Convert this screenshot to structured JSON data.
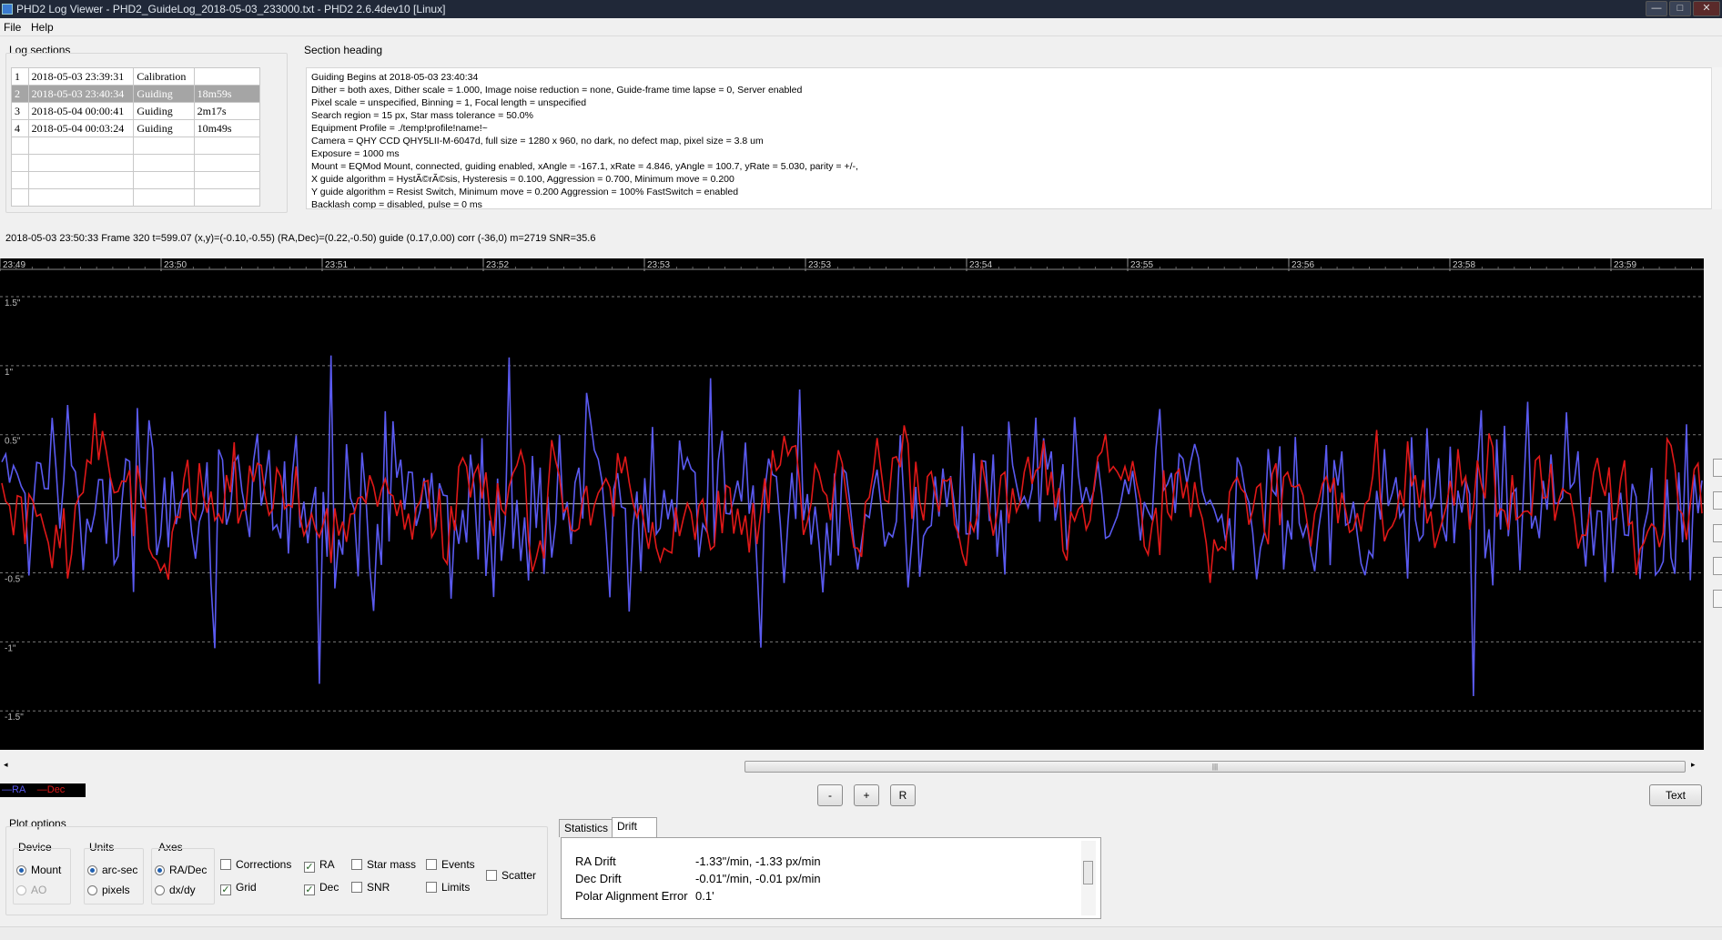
{
  "window": {
    "title": "PHD2 Log Viewer - PHD2_GuideLog_2018-05-03_233000.txt - PHD2 2.6.4dev10 [Linux]",
    "min_label": "—",
    "max_label": "□",
    "close_label": "✕"
  },
  "menu": {
    "file": "File",
    "help": "Help"
  },
  "log_sections": {
    "label": "Log sections",
    "rows": [
      {
        "num": "1",
        "time": "2018-05-03 23:39:31",
        "type": "Calibration",
        "dur": ""
      },
      {
        "num": "2",
        "time": "2018-05-03 23:40:34",
        "type": "Guiding",
        "dur": "18m59s"
      },
      {
        "num": "3",
        "time": "2018-05-04 00:00:41",
        "type": "Guiding",
        "dur": "2m17s"
      },
      {
        "num": "4",
        "time": "2018-05-04 00:03:24",
        "type": "Guiding",
        "dur": "10m49s"
      }
    ]
  },
  "section_heading": {
    "label": "Section heading",
    "lines": [
      "Guiding Begins at 2018-05-03 23:40:34",
      "Dither = both axes, Dither scale = 1.000, Image noise reduction = none, Guide-frame time lapse = 0, Server enabled",
      "Pixel scale = unspecified, Binning = 1, Focal length = unspecified",
      "Search region = 15 px, Star mass tolerance = 50.0%",
      "Equipment Profile = ./temp!profile!name!~",
      "Camera = QHY CCD QHY5LII-M-6047d, full size = 1280 x 960, no dark, no defect map, pixel size = 3.8 um",
      "Exposure = 1000 ms",
      "Mount = EQMod Mount,  connected, guiding enabled, xAngle = -167.1, xRate = 4.846, yAngle = 100.7, yRate = 5.030, parity = +/-,",
      "X guide algorithm = HystÃ©rÃ©sis, Hysteresis = 0.100, Aggression = 0.700, Minimum move = 0.200",
      "Y guide algorithm = Resist Switch, Minimum move = 0.200 Aggression = 100% FastSwitch = enabled",
      "Backlash comp = disabled, pulse = 0 ms"
    ]
  },
  "status_line": "2018-05-03 23:50:33 Frame 320 t=599.07 (x,y)=(-0.10,-0.55) (RA,Dec)=(0.22,-0.50) guide (0.17,0.00) corr (-36,0) m=2719 SNR=35.6",
  "chart_data": {
    "type": "line",
    "x_tick_labels": [
      "23:49",
      "23:50",
      "23:51",
      "23:52",
      "23:53",
      "23:53",
      "23:54",
      "23:55",
      "23:56",
      "23:58",
      "23:59"
    ],
    "y_tick_labels": [
      "1.5\"",
      "1\"",
      "0.5\"",
      "-0.5\"",
      "-1\"",
      "-1.5\""
    ],
    "y_ticks": [
      1.5,
      1,
      0.5,
      -0.5,
      -1,
      -1.5
    ],
    "ylim": [
      -1.65,
      1.5
    ],
    "grid": true,
    "series": [
      {
        "name": "RA",
        "color": "#5a5af0"
      },
      {
        "name": "Dec",
        "color": "#e01818"
      }
    ]
  },
  "legend": {
    "ra": "RA",
    "dec": "Dec",
    "ra_color": "#5a5af0",
    "dec_color": "#e01818"
  },
  "zoom_buttons": {
    "minus": "-",
    "plus": "+",
    "reset": "R",
    "text": "Text"
  },
  "plot_options": {
    "label": "Plot options",
    "device": {
      "label": "Device",
      "mount": "Mount",
      "ao": "AO"
    },
    "units": {
      "label": "Units",
      "arcsec": "arc-sec",
      "pixels": "pixels"
    },
    "axes": {
      "label": "Axes",
      "radec": "RA/Dec",
      "dxdy": "dx/dy"
    },
    "checks": {
      "corrections": "Corrections",
      "grid": "Grid",
      "ra": "RA",
      "dec": "Dec",
      "star_mass": "Star mass",
      "snr": "SNR",
      "events": "Events",
      "limits": "Limits",
      "scatter": "Scatter"
    }
  },
  "tabs": {
    "statistics": "Statistics",
    "drift": "Drift"
  },
  "drift": [
    {
      "label": "RA Drift",
      "value": "-1.33\"/min, -1.33 px/min"
    },
    {
      "label": "Dec Drift",
      "value": "-0.01\"/min, -0.01 px/min"
    },
    {
      "label": "Polar Alignment  Error",
      "value": "0.1'"
    }
  ]
}
